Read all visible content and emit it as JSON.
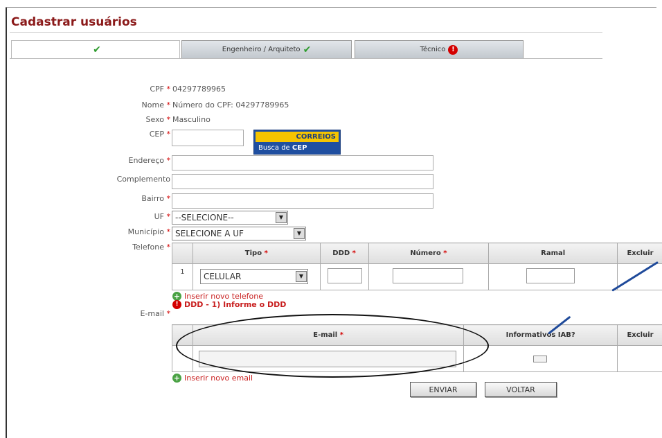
{
  "page": {
    "title": "Cadastrar usuários"
  },
  "tabs": [
    {
      "label": "",
      "status": "check"
    },
    {
      "label": "Engenheiro / Arquiteto",
      "status": "check"
    },
    {
      "label": "Técnico",
      "status": "alert"
    }
  ],
  "form": {
    "cpf": {
      "label": "CPF",
      "value": "04297789965"
    },
    "nome": {
      "label": "Nome",
      "value": "Número do CPF: 04297789965"
    },
    "sexo": {
      "label": "Sexo",
      "value": "Masculino"
    },
    "cep": {
      "label": "CEP",
      "value": ""
    },
    "correios_logo": {
      "top": "CORREIOS",
      "bottom_a": "Busca de ",
      "bottom_b": "CEP"
    },
    "endereco": {
      "label": "Endereço",
      "value": ""
    },
    "complemento": {
      "label": "Complemento",
      "value": ""
    },
    "bairro": {
      "label": "Bairro",
      "value": ""
    },
    "uf": {
      "label": "UF",
      "selected": "--SELECIONE--"
    },
    "municipio": {
      "label": "Município",
      "selected": "SELECIONE A UF"
    },
    "telefone": {
      "label": "Telefone",
      "columns": {
        "tipo": "Tipo",
        "ddd": "DDD",
        "numero": "Número",
        "ramal": "Ramal",
        "excluir": "Excluir"
      },
      "rows": [
        {
          "index": "1",
          "tipo": "CELULAR"
        }
      ],
      "add_link": "Inserir novo telefone",
      "error": "DDD - 1) Informe o DDD"
    },
    "email": {
      "label": "E-mail",
      "columns": {
        "email": "E-mail",
        "informativo": "Informativos IAB?",
        "excluir": "Excluir"
      },
      "add_link": "Inserir novo email"
    }
  },
  "buttons": {
    "enviar": "ENVIAR",
    "voltar": "VOLTAR"
  },
  "colors": {
    "title": "#8b1a1a",
    "required": "#d40000",
    "check": "#2f9c2f",
    "add": "#4aa244",
    "annotation": "#1f4a9a"
  }
}
